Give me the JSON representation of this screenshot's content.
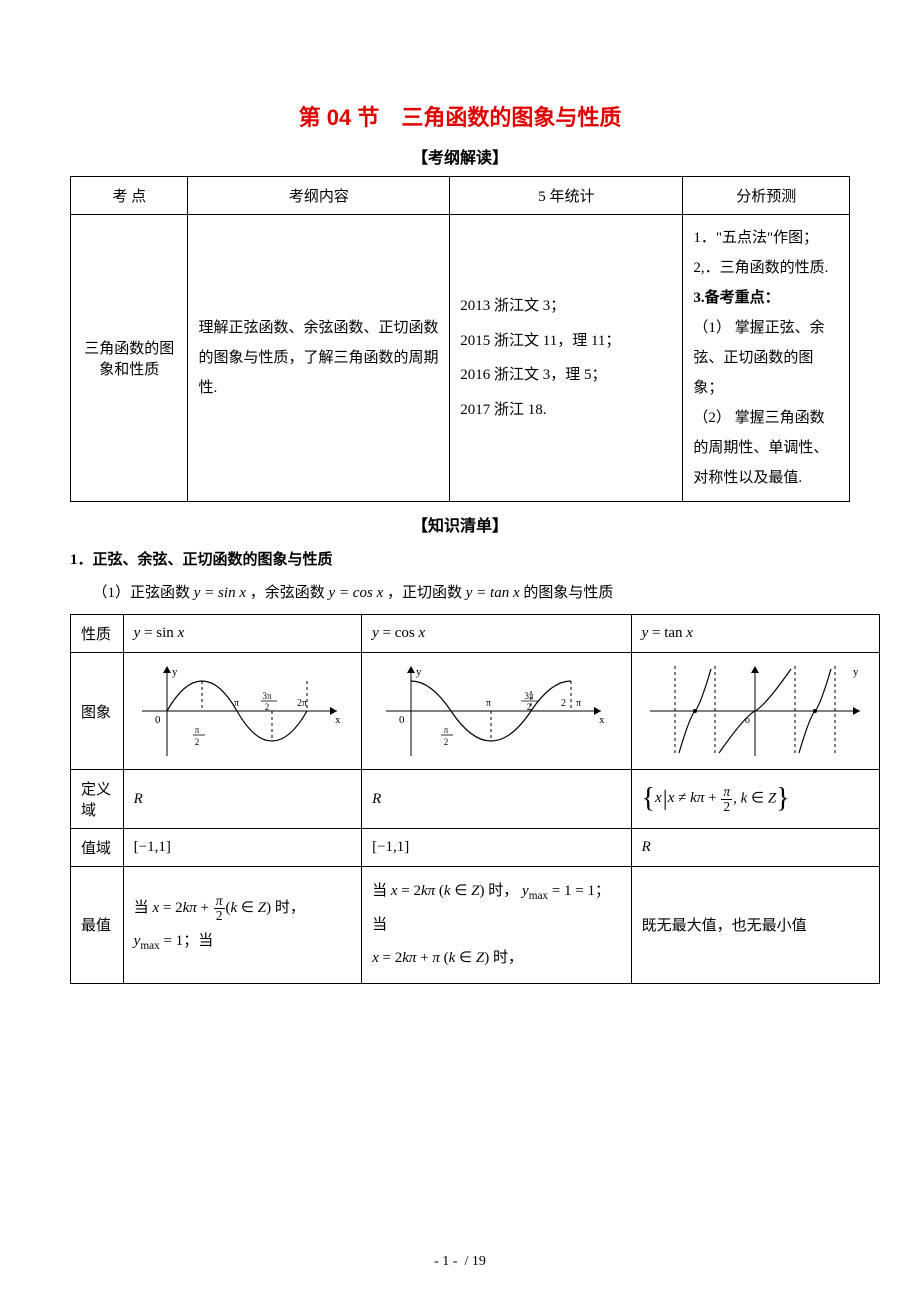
{
  "title": "第 04 节　三角函数的图象与性质",
  "section1_header": "【考纲解读】",
  "outline": {
    "headers": [
      "考 点",
      "考纲内容",
      "5 年统计",
      "分析预测"
    ],
    "row": {
      "topic": "三角函数的图象和性质",
      "content": "理解正弦函数、余弦函数、正切函数的图象与性质，了解三角函数的周期性.",
      "stats": "2013 浙江文 3；\n2015 浙江文 11，理 11；\n2016 浙江文 3，理 5；\n2017 浙江 18.",
      "predict": {
        "l1": "1．\"五点法\"作图；",
        "l2": "2,．三角函数的性质.",
        "l3_bold": "3.备考重点：",
        "l4": "（1） 掌握正弦、余弦、正切函数的图象；",
        "l5": "（2） 掌握三角函数的周期性、单调性、对称性以及最值."
      }
    }
  },
  "section2_header": "【知识清单】",
  "list_title": "1．正弦、余弦、正切函数的图象与性质",
  "list_intro_pre": "（1）正弦函数 ",
  "list_intro_mid1": "，余弦函数 ",
  "list_intro_mid2": "，正切函数 ",
  "list_intro_post": " 的图象与性质",
  "fn_sin": "y = sin x",
  "fn_cos": "y = cos x",
  "fn_tan": "y = tan x",
  "props": {
    "row_labels": [
      "性质",
      "图象",
      "定义域",
      "值域",
      "最值"
    ],
    "domain_sin": "R",
    "domain_cos": "R",
    "range_sin": "[−1,1]",
    "range_cos": "[−1,1]",
    "range_tan": "R",
    "max_sin_pre": "当 ",
    "max_sin_post": " 时，",
    "ymax1": "y",
    "ymax1_sub": "max",
    "ymax1_eq": " = 1；当",
    "max_cos_pre": "当 ",
    "max_cos_mid": " 时，",
    "max_cos_post": " = 1；当",
    "max_cos_line2_post": " 时，",
    "max_tan": "既无最大值，也无最小值"
  },
  "footer": {
    "page": "- 1 -",
    "total": "/ 19"
  }
}
